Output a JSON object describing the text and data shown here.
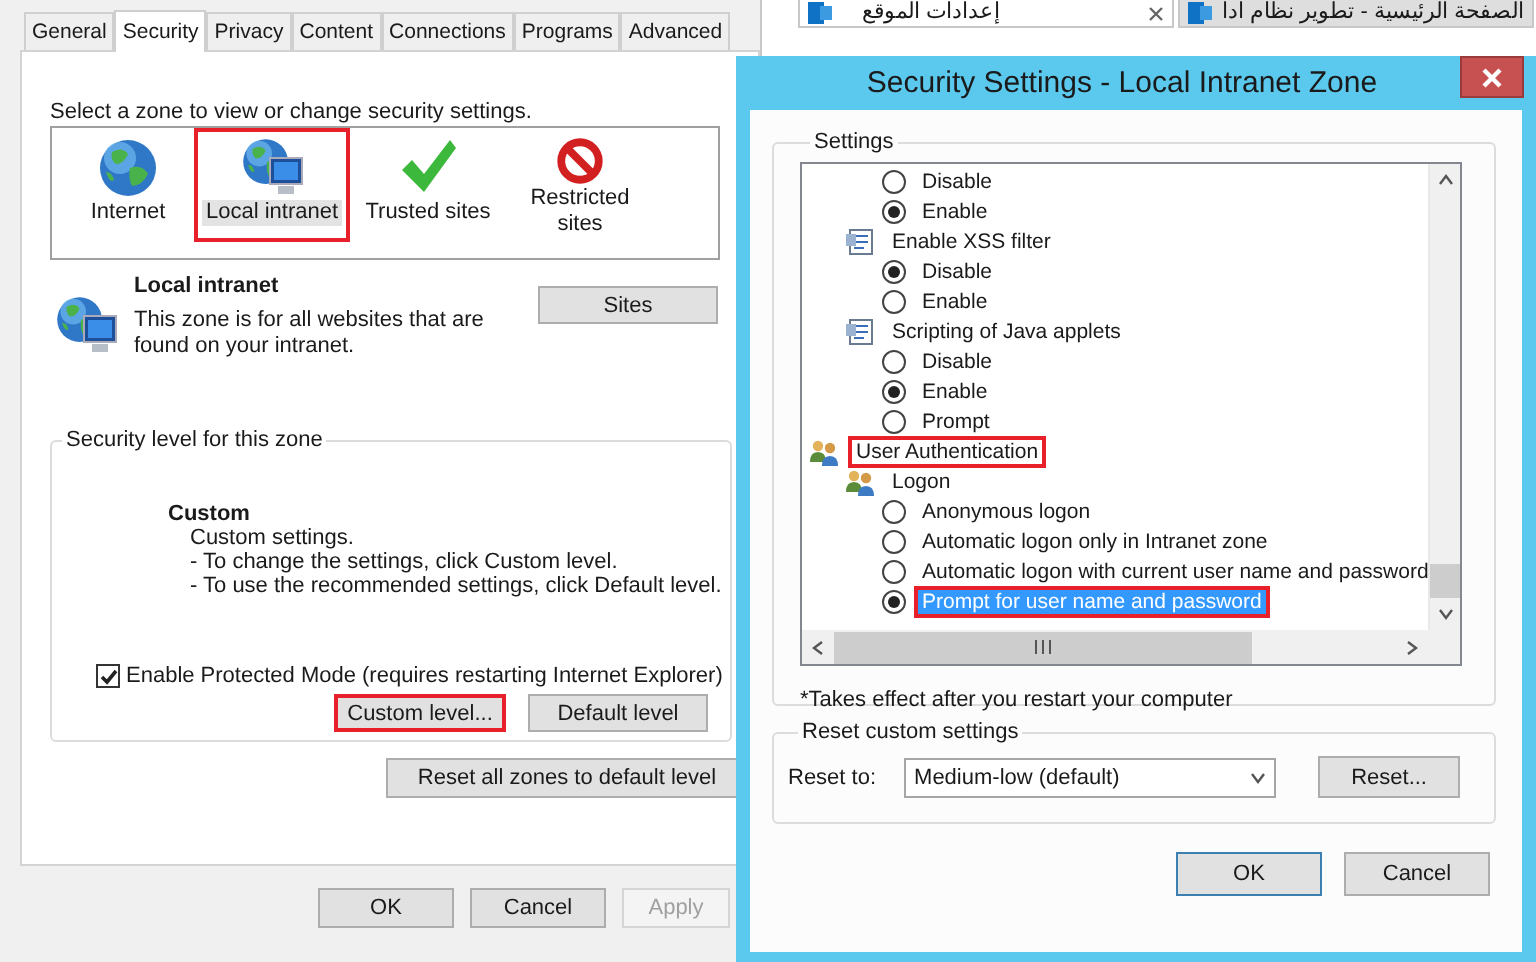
{
  "internet_options": {
    "tabs": [
      {
        "label": "General",
        "selected": false
      },
      {
        "label": "Security",
        "selected": true
      },
      {
        "label": "Privacy",
        "selected": false
      },
      {
        "label": "Content",
        "selected": false
      },
      {
        "label": "Connections",
        "selected": false
      },
      {
        "label": "Programs",
        "selected": false
      },
      {
        "label": "Advanced",
        "selected": false
      }
    ],
    "zone_prompt": "Select a zone to view or change security settings.",
    "zones": [
      {
        "label": "Internet",
        "kind": "internet",
        "selected": false,
        "annotated": false
      },
      {
        "label": "Local intranet",
        "kind": "intranet",
        "selected": true,
        "annotated": true
      },
      {
        "label": "Trusted sites",
        "kind": "trusted",
        "selected": false,
        "annotated": false
      },
      {
        "label": "Restricted sites",
        "kind": "restricted",
        "selected": false,
        "annotated": false
      }
    ],
    "zone_info": {
      "title": "Local intranet",
      "description": "This zone is for all websites that are found on your intranet."
    },
    "sites_button": "Sites",
    "security_level": {
      "legend": "Security level for this zone",
      "level_name": "Custom",
      "lines": [
        "Custom settings.",
        "- To change the settings, click Custom level.",
        "- To use the recommended settings, click Default level."
      ],
      "protected_mode": {
        "label": "Enable Protected Mode (requires restarting Internet Explorer)",
        "checked": true
      },
      "buttons": [
        {
          "label": "Custom level...",
          "annotated": true
        },
        {
          "label": "Default level",
          "annotated": false
        }
      ]
    },
    "reset_all_button": "Reset all zones to default level",
    "footer_buttons": [
      {
        "label": "OK",
        "disabled": false
      },
      {
        "label": "Cancel",
        "disabled": false
      },
      {
        "label": "Apply",
        "disabled": true
      }
    ]
  },
  "browser_tabs": [
    {
      "title": "الصفحة الرئيسية - تطوير نظام ادا",
      "selected": false
    },
    {
      "title": "إعدادات الموقع",
      "selected": true
    }
  ],
  "security_settings": {
    "title": "Security Settings - Local Intranet Zone",
    "settings_legend": "Settings",
    "tree": [
      {
        "kind": "category",
        "children": [
          {
            "kind": "script",
            "children": [
              {
                "kind": "radio",
                "label": "Disable",
                "selected": false,
                "highlighted": false,
                "annotated": false
              },
              {
                "kind": "radio",
                "label": "Enable",
                "selected": true,
                "highlighted": false,
                "annotated": false
              }
            ]
          },
          {
            "kind": "script",
            "label": "Enable XSS filter",
            "children": [
              {
                "kind": "radio",
                "label": "Disable",
                "selected": true,
                "highlighted": false,
                "annotated": false
              },
              {
                "kind": "radio",
                "label": "Enable",
                "selected": false,
                "highlighted": false,
                "annotated": false
              }
            ]
          },
          {
            "kind": "script",
            "label": "Scripting of Java applets",
            "children": [
              {
                "kind": "radio",
                "label": "Disable",
                "selected": false,
                "highlighted": false,
                "annotated": false
              },
              {
                "kind": "radio",
                "label": "Enable",
                "selected": true,
                "highlighted": false,
                "annotated": false
              },
              {
                "kind": "radio",
                "label": "Prompt",
                "selected": false,
                "highlighted": false,
                "annotated": false
              }
            ]
          }
        ]
      },
      {
        "kind": "category",
        "label": "User Authentication",
        "annotated": true,
        "children": [
          {
            "kind": "auth",
            "label": "Logon",
            "children": [
              {
                "kind": "radio",
                "label": "Anonymous logon",
                "selected": false,
                "highlighted": false,
                "annotated": false
              },
              {
                "kind": "radio",
                "label": "Automatic logon only in Intranet zone",
                "selected": false,
                "highlighted": false,
                "annotated": false
              },
              {
                "kind": "radio",
                "label": "Automatic logon with current user name and password",
                "selected": false,
                "highlighted": false,
                "annotated": false
              },
              {
                "kind": "radio",
                "label": "Prompt for user name and password",
                "selected": true,
                "highlighted": true,
                "annotated": true
              }
            ]
          }
        ]
      }
    ],
    "note": "*Takes effect after you restart your computer",
    "reset_legend": "Reset custom settings",
    "reset_label": "Reset to:",
    "reset_value": "Medium-low (default)",
    "reset_button": "Reset...",
    "buttons": [
      {
        "label": "OK",
        "focused": true
      },
      {
        "label": "Cancel",
        "focused": false
      }
    ]
  }
}
